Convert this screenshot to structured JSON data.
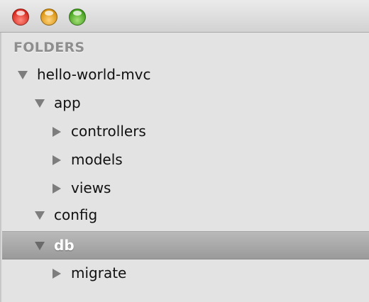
{
  "window": {
    "buttons": {
      "close_icon": "close-icon",
      "minimize_icon": "minimize-icon",
      "zoom_icon": "zoom-icon"
    },
    "colors": {
      "close": "#d8291f",
      "minimize": "#d8920f",
      "zoom": "#43a11d"
    }
  },
  "sidebar": {
    "header": "FOLDERS",
    "items": [
      {
        "label": "hello-world-mvc",
        "depth": 0,
        "expanded": true,
        "selected": false
      },
      {
        "label": "app",
        "depth": 1,
        "expanded": true,
        "selected": false
      },
      {
        "label": "controllers",
        "depth": 2,
        "expanded": false,
        "selected": false
      },
      {
        "label": "models",
        "depth": 2,
        "expanded": false,
        "selected": false
      },
      {
        "label": "views",
        "depth": 2,
        "expanded": false,
        "selected": false
      },
      {
        "label": "config",
        "depth": 1,
        "expanded": true,
        "selected": false
      },
      {
        "label": "db",
        "depth": 1,
        "expanded": true,
        "selected": true
      },
      {
        "label": "migrate",
        "depth": 2,
        "expanded": false,
        "selected": false
      }
    ],
    "colors": {
      "background": "#e3e3e3",
      "selection": "#a8a8a8",
      "disclosure": "#7d7d7d"
    }
  }
}
